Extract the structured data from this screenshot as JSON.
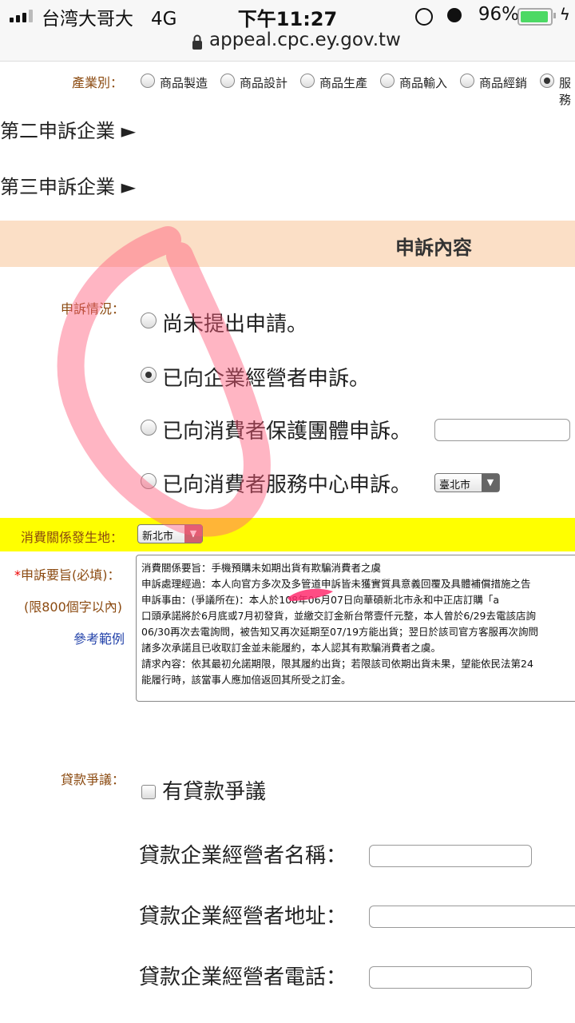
{
  "status_bar": {
    "carrier": "台湾大哥大",
    "network": "4G",
    "time": "下午11:27",
    "battery": "96%",
    "battery_level": 0.96,
    "url": "appeal.cpc.ey.gov.tw"
  },
  "industry": {
    "label": "產業別：",
    "options": [
      "商品製造",
      "商品設計",
      "商品生產",
      "商品輸入",
      "商品經銷",
      "服務"
    ],
    "selected_index": 5
  },
  "sections": {
    "second": "第二申訴企業 ►",
    "third": "第三申訴企業 ►",
    "content_title": "申訴內容"
  },
  "status": {
    "label": "申訴情況：",
    "options": [
      "尚未提出申請。",
      "已向企業經營者申訴。",
      "已向消費者保護團體申訴。",
      "已向消費者服務中心申訴。"
    ],
    "selected_index": 1,
    "center_select": "臺北市"
  },
  "location": {
    "label": "消費關係發生地：",
    "value": "新北市"
  },
  "summary": {
    "required_mark": "*",
    "label": "申訴要旨(必填)：",
    "limit": "(限800個字以內)",
    "example_link": "參考範例",
    "lines": [
      "消費關係要旨：手機預購未如期出貨有欺騙消費者之虞",
      "申訴處理經過：本人向官方多次及多管道申訴皆未獲實質具意義回覆及具體補償措施之告",
      "申訴事由：(爭議所在)：本人於108年06月07日向華碩新北市永和中正店訂購「a",
      "口頭承諾將於6月底或7月初發貨，並繳交訂金新台幣壹仟元整，本人曾於6/29去電該店詢",
      "06/30再次去電詢問，被告知又再次延期至07/19方能出貨；翌日於該司官方客服再次詢問",
      "諸多次承諾且已收取訂金並未能履約，本人認其有欺騙消費者之虞。",
      "請求內容：依其最初允諾期限，限其履約出貨；若限該司依期出貨未果，望能依民法第24",
      "能履行時，該當事人應加倍返回其所受之訂金。"
    ]
  },
  "loan": {
    "label": "貸款爭議：",
    "checkbox_label": "有貸款爭議",
    "name_label": "貸款企業經營者名稱：",
    "address_label": "貸款企業經營者地址：",
    "phone_label": "貸款企業經營者電話："
  }
}
